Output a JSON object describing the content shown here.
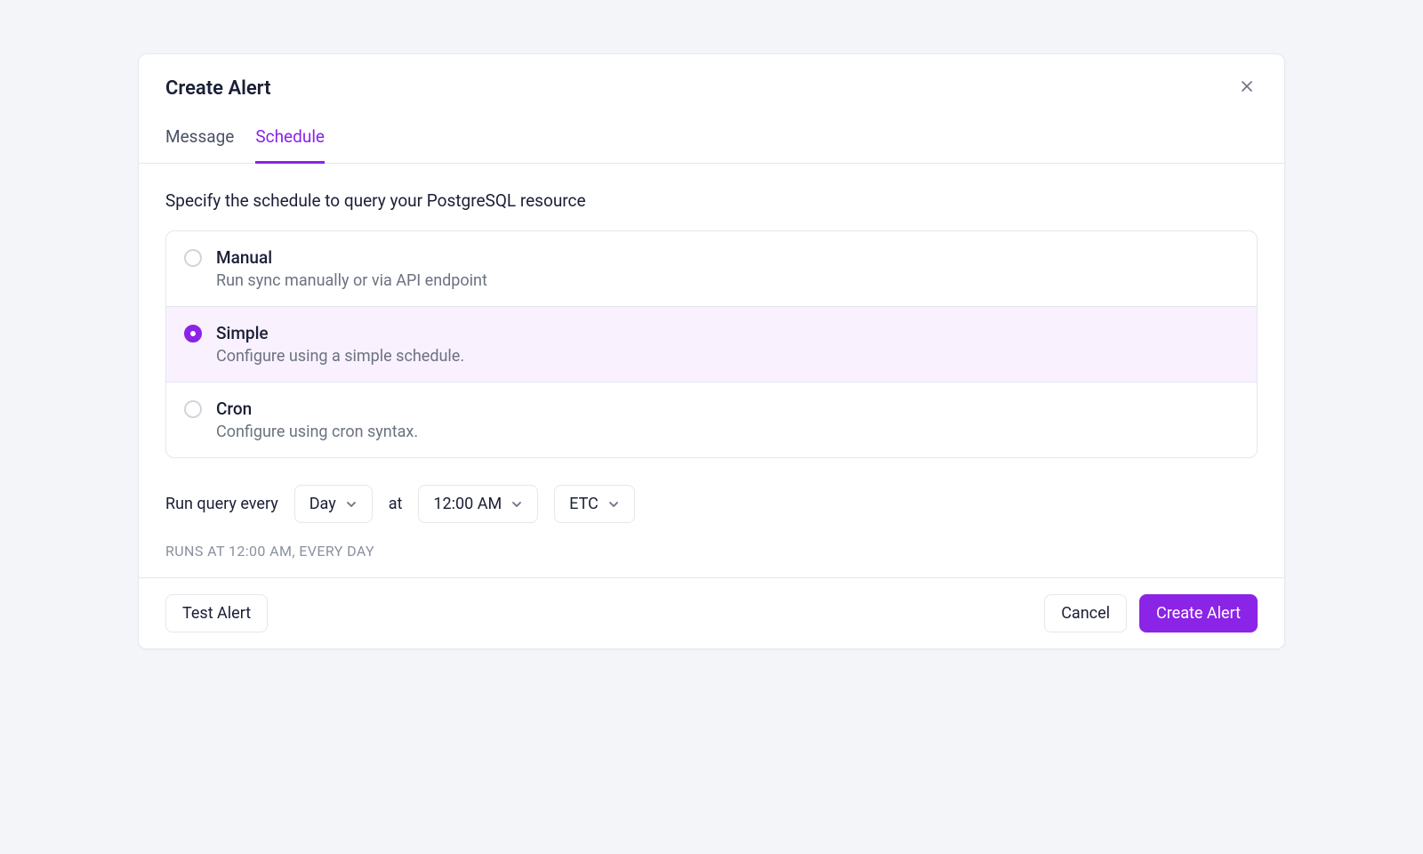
{
  "modal": {
    "title": "Create Alert",
    "tabs": [
      {
        "label": "Message",
        "active": false
      },
      {
        "label": "Schedule",
        "active": true
      }
    ],
    "instruction": "Specify the schedule to query your PostgreSQL resource",
    "options": [
      {
        "title": "Manual",
        "desc": "Run sync manually or via API endpoint",
        "selected": false
      },
      {
        "title": "Simple",
        "desc": "Configure using a simple schedule.",
        "selected": true
      },
      {
        "title": "Cron",
        "desc": "Configure using cron syntax.",
        "selected": false
      }
    ],
    "schedule": {
      "prefix": "Run query every",
      "interval": "Day",
      "atLabel": "at",
      "time": "12:00 AM",
      "tz": "ETC"
    },
    "summary": "RUNS AT 12:00 AM, EVERY DAY",
    "buttons": {
      "test": "Test Alert",
      "cancel": "Cancel",
      "create": "Create Alert"
    }
  },
  "colors": {
    "accent": "#8b24e6",
    "accentLight": "#faf1ff"
  }
}
